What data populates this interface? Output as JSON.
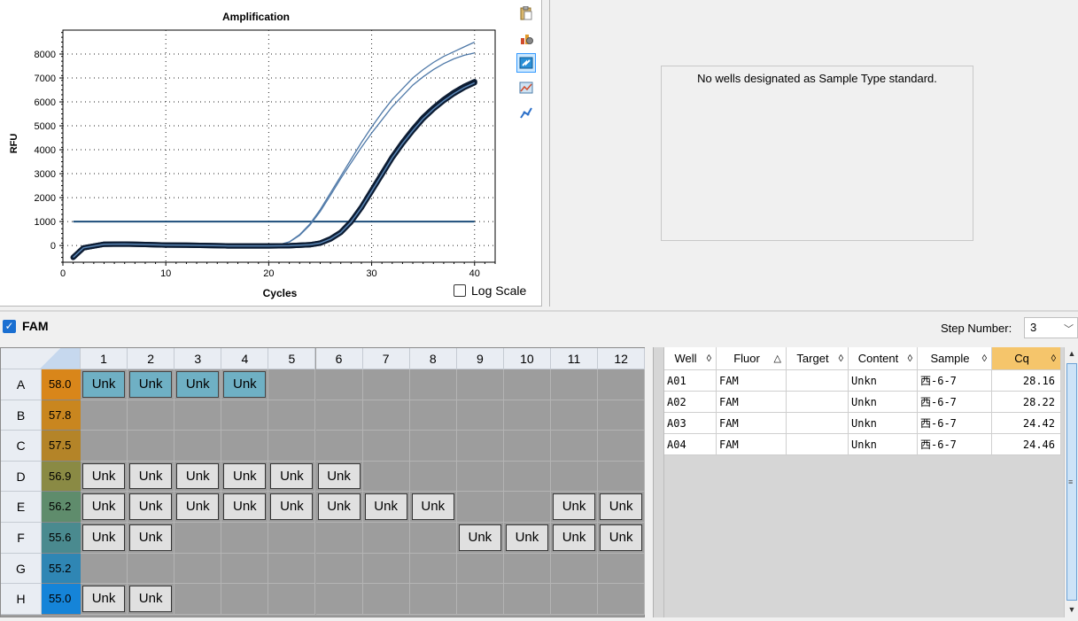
{
  "chart": {
    "title": "Amplification",
    "ylabel": "RFU",
    "xlabel": "Cycles",
    "log_scale_label": "Log Scale"
  },
  "chart_data": {
    "type": "line",
    "title": "Amplification",
    "xlabel": "Cycles",
    "ylabel": "RFU",
    "xlim": [
      0,
      42
    ],
    "ylim": [
      -700,
      9000
    ],
    "x_ticks": [
      0,
      10,
      20,
      30,
      40
    ],
    "y_ticks": [
      0,
      1000,
      2000,
      3000,
      4000,
      5000,
      6000,
      7000,
      8000
    ],
    "threshold": 1000,
    "grid": true,
    "series": [
      {
        "x": [
          1,
          2,
          4,
          6,
          8,
          10,
          12,
          14,
          16,
          18,
          20,
          21,
          22,
          23,
          24,
          25,
          26,
          27,
          28,
          29,
          30,
          31,
          32,
          33,
          34,
          35,
          36,
          37,
          38,
          39,
          40
        ],
        "values": [
          -500,
          -100,
          50,
          60,
          40,
          20,
          10,
          0,
          -10,
          -10,
          0,
          30,
          150,
          450,
          900,
          1500,
          2200,
          2900,
          3600,
          4300,
          4950,
          5550,
          6100,
          6550,
          7000,
          7350,
          7650,
          7900,
          8100,
          8300,
          8500
        ]
      },
      {
        "x": [
          1,
          2,
          4,
          6,
          8,
          10,
          12,
          14,
          16,
          18,
          20,
          21,
          22,
          23,
          24,
          25,
          26,
          27,
          28,
          29,
          30,
          31,
          32,
          33,
          34,
          35,
          36,
          37,
          38,
          39,
          40
        ],
        "values": [
          -500,
          -100,
          50,
          60,
          40,
          20,
          10,
          0,
          -10,
          -10,
          0,
          30,
          140,
          420,
          850,
          1420,
          2100,
          2800,
          3450,
          4100,
          4700,
          5250,
          5800,
          6250,
          6700,
          7050,
          7350,
          7600,
          7800,
          7950,
          8050
        ]
      },
      {
        "x": [
          1,
          2,
          4,
          6,
          8,
          10,
          12,
          14,
          16,
          18,
          20,
          22,
          24,
          25,
          26,
          27,
          28,
          29,
          30,
          31,
          32,
          33,
          34,
          35,
          36,
          37,
          38,
          39,
          40
        ],
        "values": [
          -500,
          -100,
          50,
          60,
          40,
          20,
          10,
          0,
          -20,
          -20,
          -20,
          -10,
          30,
          100,
          280,
          550,
          1000,
          1600,
          2300,
          3000,
          3700,
          4300,
          4850,
          5350,
          5750,
          6100,
          6400,
          6650,
          6850
        ]
      },
      {
        "x": [
          1,
          2,
          4,
          6,
          8,
          10,
          12,
          14,
          16,
          18,
          20,
          22,
          24,
          25,
          26,
          27,
          28,
          29,
          30,
          31,
          32,
          33,
          34,
          35,
          36,
          37,
          38,
          39,
          40
        ],
        "values": [
          -500,
          -100,
          50,
          60,
          40,
          20,
          10,
          0,
          -20,
          -20,
          -20,
          -10,
          30,
          100,
          270,
          540,
          980,
          1580,
          2270,
          2960,
          3660,
          4260,
          4800,
          5300,
          5700,
          6050,
          6350,
          6600,
          6800
        ]
      }
    ]
  },
  "standard_panel": {
    "message": "No wells designated as Sample Type standard."
  },
  "fluor_bar": {
    "fluor": "FAM",
    "step_label": "Step Number:",
    "step_value": "3"
  },
  "plate": {
    "columns": [
      "1",
      "2",
      "3",
      "4",
      "5",
      "6",
      "7",
      "8",
      "9",
      "10",
      "11",
      "12"
    ],
    "rows": [
      {
        "label": "A",
        "temp": "58.0",
        "temp_color": "#d9861a",
        "wells": [
          "Unk",
          "Unk",
          "Unk",
          "Unk",
          "",
          "",
          "",
          "",
          "",
          "",
          "",
          ""
        ]
      },
      {
        "label": "B",
        "temp": "57.8",
        "temp_color": "#c9861f",
        "wells": [
          "",
          "",
          "",
          "",
          "",
          "",
          "",
          "",
          "",
          "",
          "",
          ""
        ]
      },
      {
        "label": "C",
        "temp": "57.5",
        "temp_color": "#b48428",
        "wells": [
          "",
          "",
          "",
          "",
          "",
          "",
          "",
          "",
          "",
          "",
          "",
          ""
        ]
      },
      {
        "label": "D",
        "temp": "56.9",
        "temp_color": "#8a8a44",
        "wells": [
          "Unk",
          "Unk",
          "Unk",
          "Unk",
          "Unk",
          "Unk",
          "",
          "",
          "",
          "",
          "",
          ""
        ]
      },
      {
        "label": "E",
        "temp": "56.2",
        "temp_color": "#5f8c6c",
        "wells": [
          "Unk",
          "Unk",
          "Unk",
          "Unk",
          "Unk",
          "Unk",
          "Unk",
          "Unk",
          "",
          "",
          "Unk",
          "Unk"
        ]
      },
      {
        "label": "F",
        "temp": "55.6",
        "temp_color": "#4a8a8f",
        "wells": [
          "Unk",
          "Unk",
          "",
          "",
          "",
          "",
          "",
          "",
          "Unk",
          "Unk",
          "Unk",
          "Unk"
        ]
      },
      {
        "label": "G",
        "temp": "55.2",
        "temp_color": "#2f86b4",
        "wells": [
          "",
          "",
          "",
          "",
          "",
          "",
          "",
          "",
          "",
          "",
          "",
          ""
        ]
      },
      {
        "label": "H",
        "temp": "55.0",
        "temp_color": "#1584d8",
        "wells": [
          "Unk",
          "Unk",
          "",
          "",
          "",
          "",
          "",
          "",
          "",
          "",
          "",
          ""
        ]
      }
    ],
    "selected_wells": [
      "A1",
      "A2",
      "A3",
      "A4"
    ]
  },
  "results": {
    "headers": [
      "Well",
      "Fluor",
      "Target",
      "Content",
      "Sample",
      "Cq"
    ],
    "sort_icons": [
      "◊",
      "△",
      "◊",
      "◊",
      "◊",
      "◊"
    ],
    "rows": [
      [
        "A01",
        "FAM",
        "",
        "Unkn",
        "西-6-7",
        "28.16"
      ],
      [
        "A02",
        "FAM",
        "",
        "Unkn",
        "西-6-7",
        "28.22"
      ],
      [
        "A03",
        "FAM",
        "",
        "Unkn",
        "西-6-7",
        "24.42"
      ],
      [
        "A04",
        "FAM",
        "",
        "Unkn",
        "西-6-7",
        "24.46"
      ]
    ]
  },
  "toolbar_icons": [
    "clipboard-icon",
    "chart-settings-icon",
    "export-icon",
    "graph-image-icon",
    "trend-line-icon"
  ]
}
